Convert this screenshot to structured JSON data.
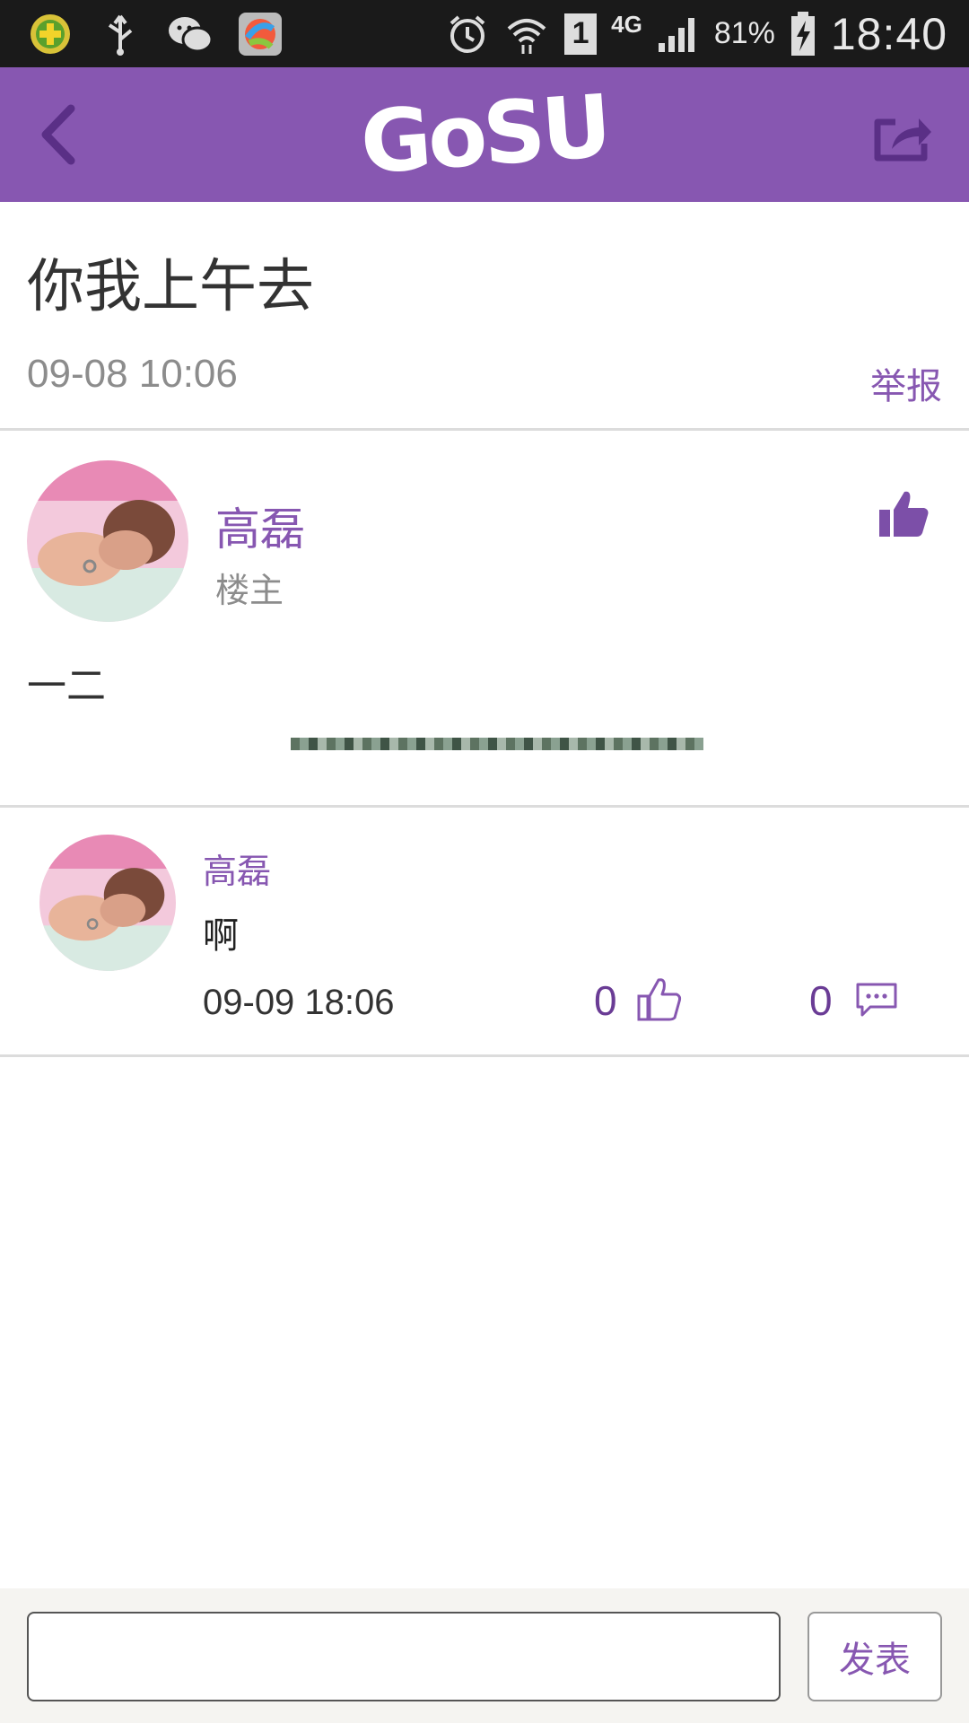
{
  "status_bar": {
    "network": "4G",
    "sim_slot": "1",
    "battery_percent": "81%",
    "time": "18:40"
  },
  "app_bar": {
    "logo_text": "GoSU"
  },
  "topic": {
    "title": "你我上午去",
    "timestamp": "09-08 10:06",
    "report_label": "举报"
  },
  "post": {
    "author_name": "高磊",
    "author_role": "楼主",
    "body": "一二"
  },
  "replies": [
    {
      "author_name": "高磊",
      "text": "啊",
      "timestamp": "09-09 18:06",
      "like_count": "0",
      "comment_count": "0"
    }
  ],
  "composer": {
    "input_value": "",
    "input_placeholder": "",
    "submit_label": "发表"
  },
  "colors": {
    "brand_purple": "#8757b1",
    "status_bar_bg": "#1a1a1a",
    "divider": "#dcdcdc"
  }
}
